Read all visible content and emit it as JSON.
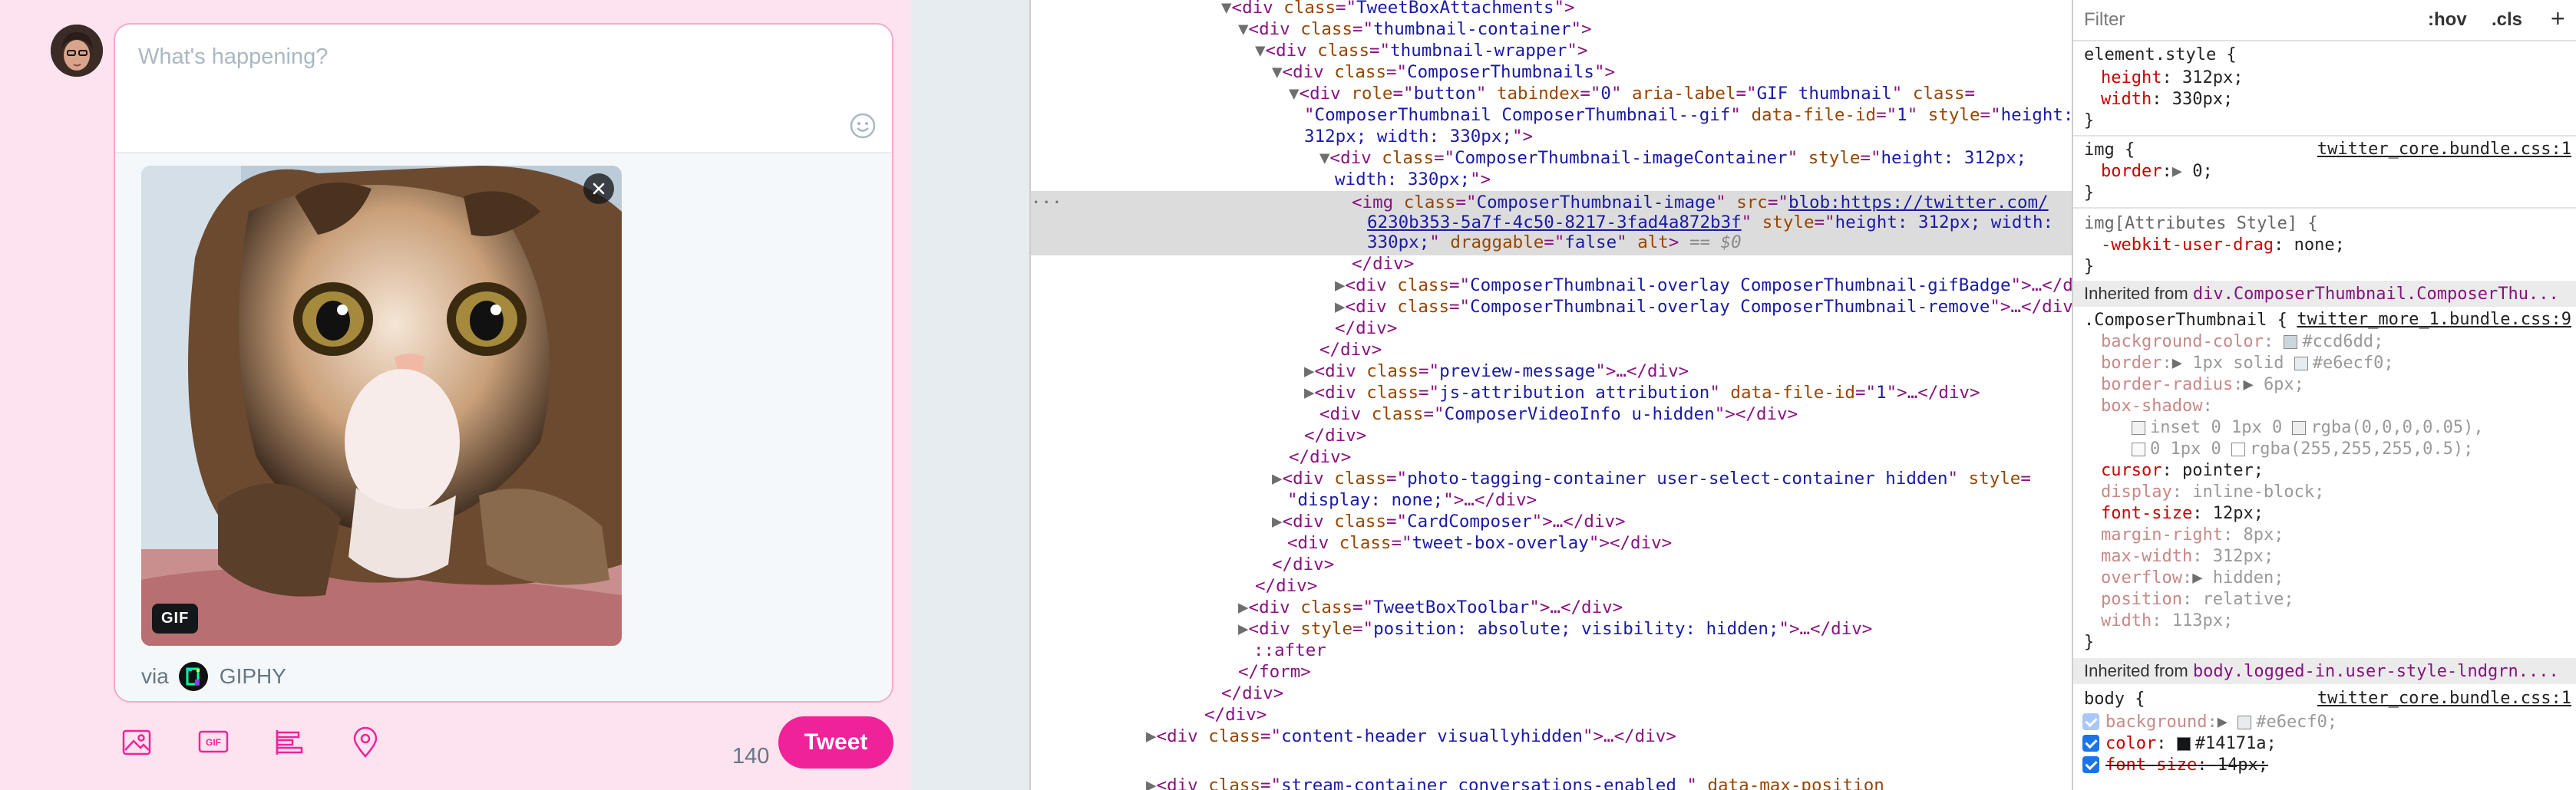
{
  "compose": {
    "placeholder": "What's happening?",
    "gif_badge": "GIF",
    "attribution_via": "via",
    "attribution_source": "GIPHY",
    "char_count": "140",
    "tweet_button": "Tweet",
    "toolbar_icons": [
      "image-icon",
      "gif-icon",
      "poll-icon",
      "location-icon"
    ],
    "accent_color": "#f0229a",
    "background_color": "#fde2ef"
  },
  "elements": {
    "l0": {
      "tag": "div",
      "attr": "class",
      "val": "TweetBoxAttachments"
    },
    "l1": {
      "tag": "div",
      "attr": "class",
      "val": "thumbnail-container"
    },
    "l2": {
      "tag": "div",
      "attr": "class",
      "val": "thumbnail-wrapper"
    },
    "l3": {
      "tag": "div",
      "attr": "class",
      "val": "ComposerThumbnails"
    },
    "l4": {
      "tag": "div",
      "role": "button",
      "tabindex": "0",
      "aria_label": "GIF thumbnail",
      "class_val_a": "ComposerThumbnail ComposerThumbnail--gif",
      "file_id": "1",
      "style_a": "height:",
      "style_b": "312px; width: 330px;"
    },
    "l5": {
      "tag": "div",
      "class_val": "ComposerThumbnail-imageContainer",
      "style_a": "height: 312px;",
      "style_b": "width: 330px;"
    },
    "l6": {
      "tag": "img",
      "class_val": "ComposerThumbnail-image",
      "src_a": "blob:https://twitter.com/",
      "src_b": "6230b353-5a7f-4c50-8217-3fad4a872b3f",
      "style_a": "height: 312px; width:",
      "style_b": "330px;",
      "draggable": "false",
      "eq": "== $0"
    },
    "l7": "</div>",
    "l8": {
      "tag": "div",
      "class_val": "ComposerThumbnail-overlay ComposerThumbnail-gifBadge"
    },
    "l9": {
      "tag": "div",
      "class_val": "ComposerThumbnail-overlay ComposerThumbnail-remove"
    },
    "l10": "</div>",
    "l11": "</div>",
    "l12": {
      "tag": "div",
      "class_val": "preview-message"
    },
    "l13": {
      "tag": "div",
      "class_val": "js-attribution attribution",
      "file_id": "1"
    },
    "l14": {
      "tag": "div",
      "class_val": "ComposerVideoInfo u-hidden"
    },
    "l15": "</div>",
    "l16": "</div>",
    "l17": {
      "tag": "div",
      "class_val": "photo-tagging-container user-select-container hidden",
      "style_a": "",
      "style_b": "display: none;"
    },
    "l18": {
      "tag": "div",
      "class_val": "CardComposer"
    },
    "l19": {
      "tag": "div",
      "class_val": "tweet-box-overlay"
    },
    "l20": "</div>",
    "l21": "</div>",
    "l22": {
      "tag": "div",
      "class_val": "TweetBoxToolbar"
    },
    "l23": {
      "tag": "div",
      "style_val": "position: absolute; visibility: hidden;"
    },
    "l24": "::after",
    "l25": "</form>",
    "l26": "</div>",
    "l27": "</div>",
    "l28": {
      "tag": "div",
      "class_val": "content-header visuallyhidden"
    },
    "l29": {
      "tag": "div",
      "class_val": "stream-container conversations-enabled ",
      "attr2": "data-max-position"
    }
  },
  "styles": {
    "filter_placeholder": "Filter",
    "hov": ":hov",
    "cls": ".cls",
    "plus": "+",
    "element_style": {
      "selector": "element.style {",
      "rules": [
        {
          "prop": "height",
          "val": "312px;"
        },
        {
          "prop": "width",
          "val": "330px;"
        }
      ],
      "close": "}"
    },
    "img_rule": {
      "selector": "img {",
      "source": "twitter_core.bundle.css:1",
      "rules": [
        {
          "prop": "border",
          "val": "0;"
        }
      ],
      "close": "}"
    },
    "img_attr_rule": {
      "selector": "img[Attributes Style] {",
      "rules": [
        {
          "prop": "-webkit-user-drag",
          "val": "none;"
        }
      ],
      "close": "}"
    },
    "inherited_1": {
      "label": "Inherited from",
      "selector": "div.ComposerThumbnail.ComposerThu..."
    },
    "composer_rule": {
      "selector": ".ComposerThumbnail {",
      "source": "twitter_more_1.bundle.css:9",
      "rules": [
        {
          "prop": "background-color",
          "val": "#ccd6dd;",
          "color": "#ccd6dd"
        },
        {
          "prop": "border",
          "val": "1px solid",
          "val2": "#e6ecf0;",
          "color": "#e6ecf0"
        },
        {
          "prop": "border-radius",
          "val": "6px;"
        },
        {
          "prop": "box-shadow",
          "val": ""
        },
        {
          "prop": "",
          "val": "inset 0 1px 0",
          "val2": "rgba(0,0,0,0.05),",
          "color": "#f2f2f2"
        },
        {
          "prop": "",
          "val": "0 1px 0",
          "val2": "rgba(255,255,255,0.5);",
          "color": "#ffffff"
        },
        {
          "prop": "cursor",
          "val": "pointer;"
        },
        {
          "prop": "display",
          "val": "inline-block;"
        },
        {
          "prop": "font-size",
          "val": "12px;"
        },
        {
          "prop": "margin-right",
          "val": "8px;"
        },
        {
          "prop": "max-width",
          "val": "312px;"
        },
        {
          "prop": "overflow",
          "val": "hidden;"
        },
        {
          "prop": "position",
          "val": "relative;"
        },
        {
          "prop": "width",
          "val": "113px;"
        }
      ],
      "close": "}"
    },
    "inherited_2": {
      "label": "Inherited from",
      "selector": "body.logged-in.user-style-lndgrn...."
    },
    "body_rule": {
      "selector": "body {",
      "source": "twitter_core.bundle.css:1",
      "rules": [
        {
          "prop": "background",
          "val": "#e6ecf0;",
          "color": "#e6ecf0"
        },
        {
          "prop": "color",
          "val": "#14171a;",
          "color": "#14171a"
        },
        {
          "prop": "font-size",
          "val": "14px;"
        }
      ]
    }
  }
}
